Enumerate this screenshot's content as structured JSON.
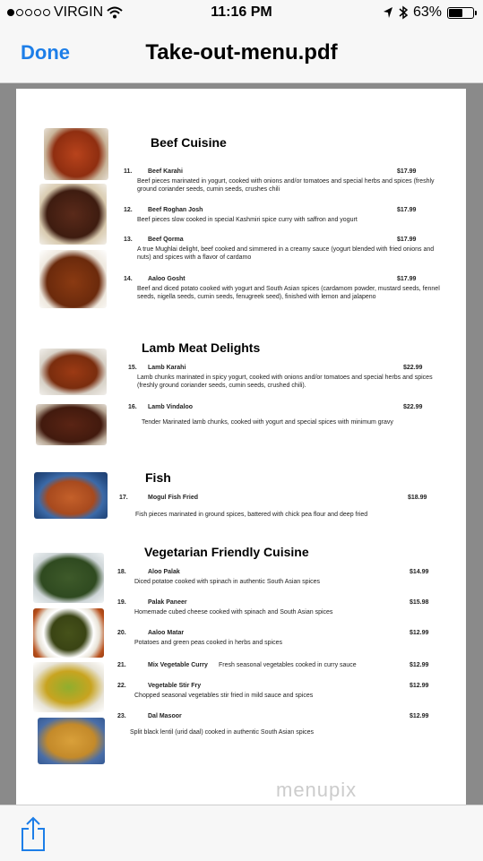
{
  "status": {
    "carrier": "VIRGIN",
    "time": "11:16 PM",
    "battery": "63%",
    "battery_level": 0.63
  },
  "nav": {
    "done": "Done",
    "title": "Take-out-menu.pdf"
  },
  "menu": {
    "sections": [
      {
        "title": "Beef Cuisine",
        "items": [
          {
            "num": "11.",
            "name": "Beef Karahi",
            "price": "$17.99",
            "desc": "Beef pieces marinated in yogurt, cooked with onions and/or tomatoes and special herbs and spices (freshly ground coriander seeds, cumin seeds, crushes chili"
          },
          {
            "num": "12.",
            "name": "Beef Roghan Josh",
            "price": "$17.99",
            "desc": "Beef pieces slow cooked in special Kashmiri spice curry with saffron and yogurt"
          },
          {
            "num": "13.",
            "name": "Beef Qorma",
            "price": "$17.99",
            "desc": "A true Mughlai delight, beef cooked and simmered in a creamy sauce (yogurt blended with fried onions and nuts) and spices with a flavor of cardamo"
          },
          {
            "num": "14.",
            "name": "Aaloo Gosht",
            "price": "$17.99",
            "desc": "Beef and diced potato cooked with yogurt and South Asian spices (cardamom powder, mustard seeds, fennel seeds, nigella seeds, cumin seeds, fenugreek seed), finished with lemon and jalapeno"
          }
        ]
      },
      {
        "title": "Lamb Meat Delights",
        "items": [
          {
            "num": "15.",
            "name": "Lamb Karahi",
            "price": "$22.99",
            "desc": "Lamb chunks marinated in spicy yogurt, cooked with onions and/or tomatoes and special herbs and spices (freshly ground coriander seeds, cumin seeds, crushed chili)."
          },
          {
            "num": "16.",
            "name": "Lamb Vindaloo",
            "price": "$22.99",
            "desc": "Tender Marinated lamb chunks, cooked with yogurt and special spices with minimum gravy"
          }
        ]
      },
      {
        "title": "Fish",
        "items": [
          {
            "num": "17.",
            "name": "Mogul Fish Fried",
            "price": "$18.99",
            "desc": "Fish pieces marinated in ground spices, battered with chick pea flour and deep fried"
          }
        ]
      },
      {
        "title": "Vegetarian Friendly Cuisine",
        "items": [
          {
            "num": "18.",
            "name": "Aloo Palak",
            "price": "$14.99",
            "desc": "Diced potatoe cooked with spinach in authentic South Asian spices"
          },
          {
            "num": "19.",
            "name": "Palak Paneer",
            "price": "$15.98",
            "desc": "Homemade cubed cheese cooked with spinach and South Asian spices"
          },
          {
            "num": "20.",
            "name": "Aaloo Matar",
            "price": "$12.99",
            "desc": "Potatoes and green peas cooked in herbs and spices"
          },
          {
            "num": "21.",
            "name": "Mix Vegetable Curry",
            "price": "$12.99",
            "desc": "Fresh seasonal vegetables cooked in curry sauce"
          },
          {
            "num": "22.",
            "name": "Vegetable Stir Fry",
            "price": "$12.99",
            "desc": "Chopped seasonal vegetables stir fried in mild sauce and spices"
          },
          {
            "num": "23.",
            "name": "Dal Masoor",
            "price": "$12.99",
            "desc": "Split black lentil (urid daal) cooked in authentic South Asian spices"
          }
        ]
      }
    ]
  },
  "watermark": "menupix",
  "toolbar": {
    "share_icon": "share-icon"
  }
}
